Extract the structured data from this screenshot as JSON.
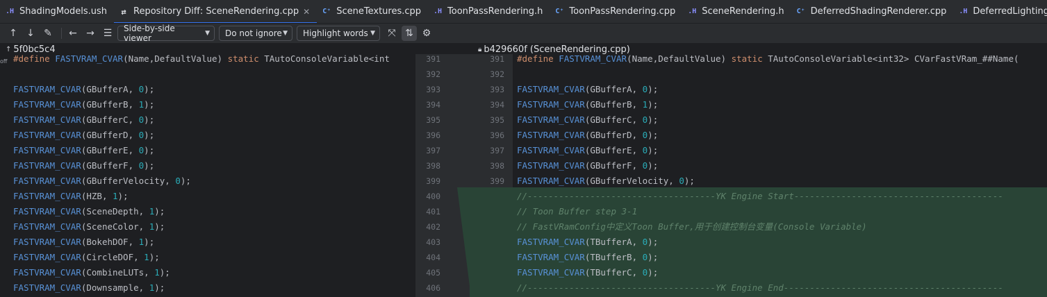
{
  "tabs": [
    {
      "icon": "H",
      "type": "h",
      "label": "ShadingModels.ush",
      "active": false
    },
    {
      "icon": "diff",
      "type": "diff",
      "label": "Repository Diff: SceneRendering.cpp",
      "active": true
    },
    {
      "icon": "C",
      "type": "cpp",
      "label": "SceneTextures.cpp",
      "active": false
    },
    {
      "icon": "H",
      "type": "h",
      "label": "ToonPassRendering.h",
      "active": false
    },
    {
      "icon": "C",
      "type": "cpp",
      "label": "ToonPassRendering.cpp",
      "active": false
    },
    {
      "icon": "H",
      "type": "h",
      "label": "SceneRendering.h",
      "active": false
    },
    {
      "icon": "C",
      "type": "cpp",
      "label": "DeferredShadingRenderer.cpp",
      "active": false
    },
    {
      "icon": "H",
      "type": "h",
      "label": "DeferredLightingCommon.ush",
      "active": false
    }
  ],
  "toolbar": {
    "viewer_mode": "Side-by-side viewer",
    "ignore_mode": "Do not ignore",
    "highlight_mode": "Highlight words"
  },
  "revisions": {
    "left": "5f0bc5c4",
    "right": "b429660f (SceneRendering.cpp)"
  },
  "scroll_indicator": "off",
  "left_lines": [
    "#define FASTVRAM_CVAR(Name,DefaultValue) static TAutoConsoleVariable<int",
    "",
    "FASTVRAM_CVAR(GBufferA, 0);",
    "FASTVRAM_CVAR(GBufferB, 1);",
    "FASTVRAM_CVAR(GBufferC, 0);",
    "FASTVRAM_CVAR(GBufferD, 0);",
    "FASTVRAM_CVAR(GBufferE, 0);",
    "FASTVRAM_CVAR(GBufferF, 0);",
    "FASTVRAM_CVAR(GBufferVelocity, 0);",
    "FASTVRAM_CVAR(HZB, 1);",
    "FASTVRAM_CVAR(SceneDepth, 1);",
    "FASTVRAM_CVAR(SceneColor, 1);",
    "FASTVRAM_CVAR(BokehDOF, 1);",
    "FASTVRAM_CVAR(CircleDOF, 1);",
    "FASTVRAM_CVAR(CombineLUTs, 1);",
    "FASTVRAM_CVAR(Downsample, 1);"
  ],
  "left_numbers": [
    "391",
    "392",
    "393",
    "394",
    "395",
    "396",
    "397",
    "398",
    "399",
    "400",
    "401",
    "402",
    "403",
    "404",
    "405",
    "406"
  ],
  "right_numbers": [
    "391",
    "392",
    "393",
    "394",
    "395",
    "396",
    "397",
    "398",
    "399",
    "400",
    "401",
    "402",
    "403",
    "404",
    "405",
    "406"
  ],
  "right_lines": [
    "#define FASTVRAM_CVAR(Name,DefaultValue) static TAutoConsoleVariable<int32> CVarFastVRam_##Name(",
    "",
    "FASTVRAM_CVAR(GBufferA, 0);",
    "FASTVRAM_CVAR(GBufferB, 1);",
    "FASTVRAM_CVAR(GBufferC, 0);",
    "FASTVRAM_CVAR(GBufferD, 0);",
    "FASTVRAM_CVAR(GBufferE, 0);",
    "FASTVRAM_CVAR(GBufferF, 0);",
    "FASTVRAM_CVAR(GBufferVelocity, 0);",
    "//------------------------------------YK Engine Start----------------------------------------",
    "// Toon Buffer step 3-1",
    "// FastVRamConfig中定义Toon Buffer,用于创建控制台变量(Console Variable)",
    "FASTVRAM_CVAR(TBufferA, 0);",
    "FASTVRAM_CVAR(TBufferB, 0);",
    "FASTVRAM_CVAR(TBufferC, 0);",
    "//------------------------------------YK Engine End------------------------------------------"
  ],
  "colors": {
    "added_bg": "#294436",
    "accent": "#3574f0"
  }
}
